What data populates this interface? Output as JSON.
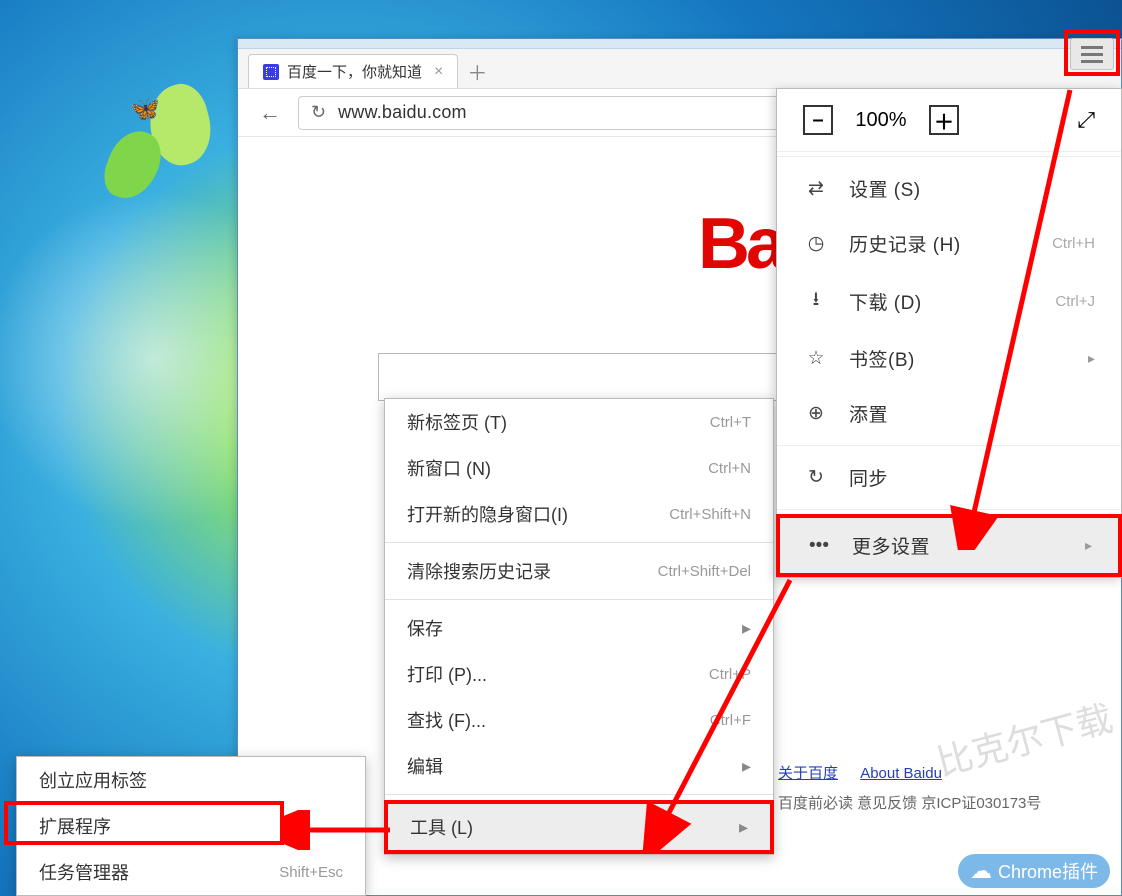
{
  "desktop": {
    "butterfly_icon": "🦋"
  },
  "browser": {
    "tab_title": "百度一下，你就知道",
    "url": "www.baidu.com",
    "new_tab_glyph": "＋",
    "close_glyph": "×",
    "back_glyph": "←",
    "reload_glyph": "↻"
  },
  "page": {
    "logo_fragment": "Ba",
    "footer_link1": "关于百度",
    "footer_link2": "About Baidu",
    "footer_line2": "百度前必读 意见反馈 京ICP证030173号"
  },
  "hamburger": {
    "aria": "menu"
  },
  "main_menu": {
    "zoom_minus": "–",
    "zoom_value": "100%",
    "zoom_plus": "＋",
    "fullscreen_glyph": "⤢",
    "items": [
      {
        "icon": "⇄",
        "label": "设置 (S)"
      },
      {
        "icon": "◷",
        "label": "历史记录 (H)",
        "shortcut": "Ctrl+H"
      },
      {
        "icon": "⭳",
        "label": "下载 (D)",
        "shortcut": "Ctrl+J"
      },
      {
        "icon": "☆",
        "label": "书签(B)",
        "arrow": "▸"
      },
      {
        "icon": "⊕",
        "label": "添置"
      },
      {
        "icon": "↻",
        "label": "同步"
      }
    ],
    "more": {
      "icon": "•••",
      "label": "更多设置",
      "arrow": "▸"
    }
  },
  "submenu": {
    "items_a": [
      {
        "label": "新标签页 (T)",
        "shortcut": "Ctrl+T"
      },
      {
        "label": "新窗口 (N)",
        "shortcut": "Ctrl+N"
      },
      {
        "label": "打开新的隐身窗口(I)",
        "shortcut": "Ctrl+Shift+N"
      }
    ],
    "items_b": [
      {
        "label": "清除搜索历史记录",
        "shortcut": "Ctrl+Shift+Del"
      }
    ],
    "items_c": [
      {
        "label": "保存",
        "arrow": "▸"
      },
      {
        "label": "打印 (P)...",
        "shortcut": "Ctrl+P"
      },
      {
        "label": "查找 (F)...",
        "shortcut": "Ctrl+F"
      },
      {
        "label": "编辑",
        "arrow": "▸"
      }
    ],
    "tools": {
      "label": "工具 (L)",
      "arrow": "▸"
    }
  },
  "subsub": {
    "items": [
      {
        "label": "创立应用标签"
      },
      {
        "label": "扩展程序"
      },
      {
        "label": "任务管理器",
        "shortcut": "Shift+Esc"
      }
    ]
  },
  "watermark": {
    "text": "Chrome插件",
    "faded": "比克尔下载"
  }
}
